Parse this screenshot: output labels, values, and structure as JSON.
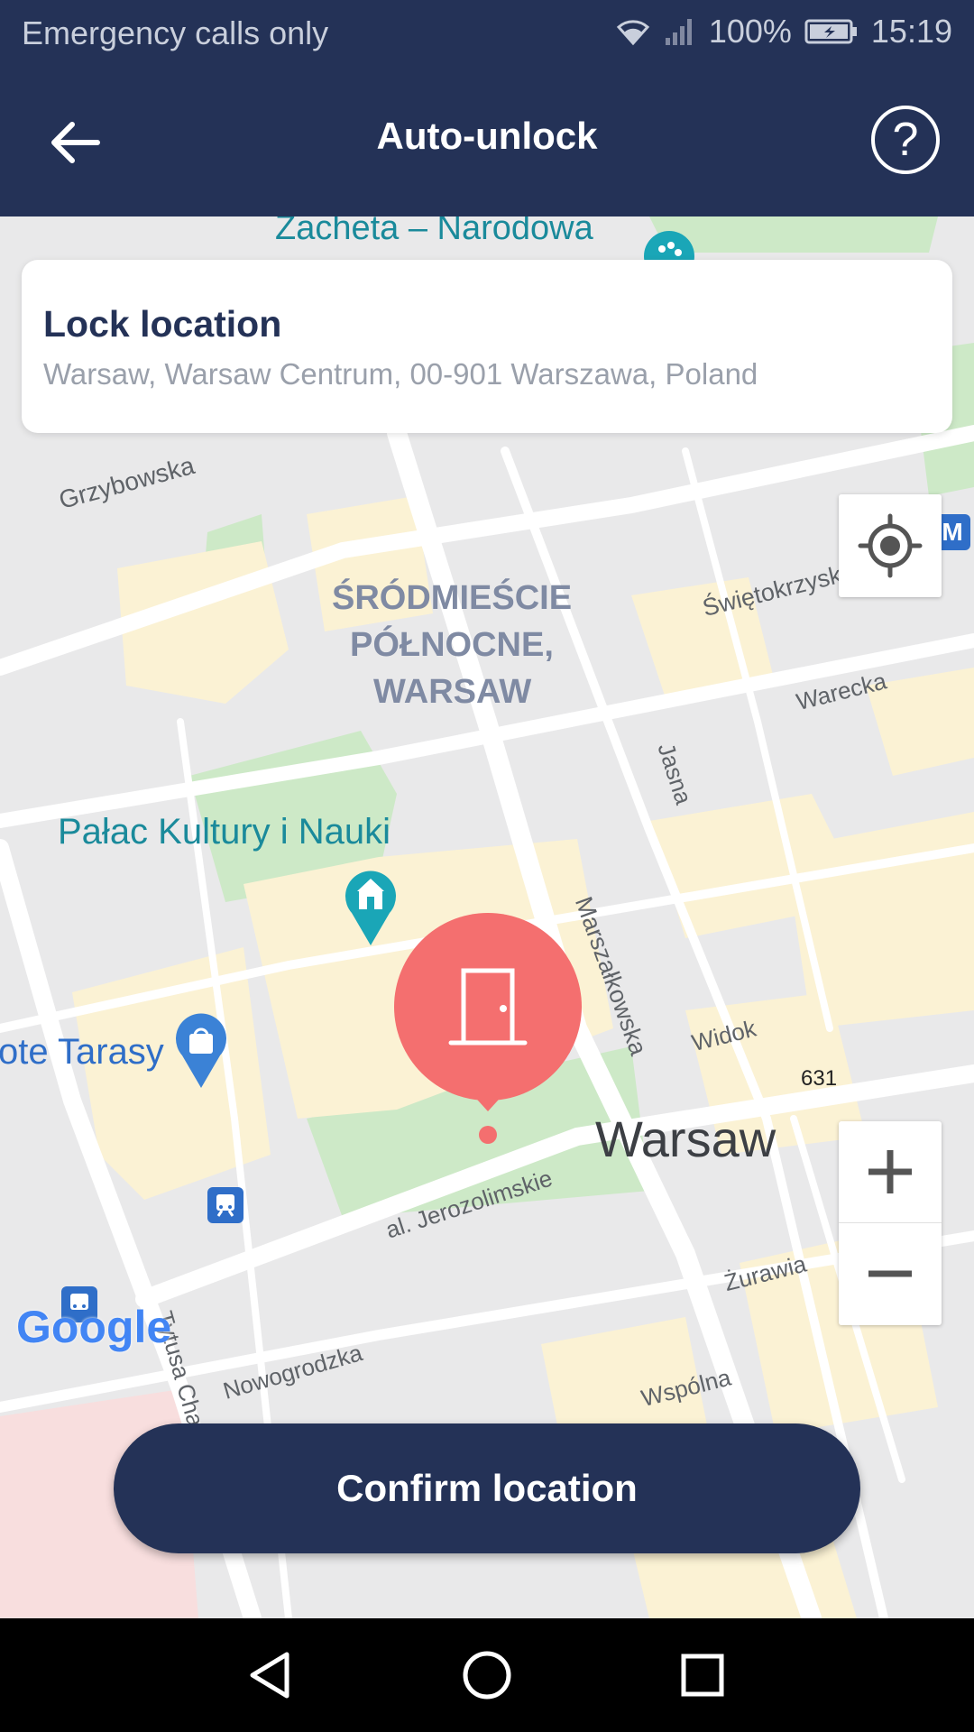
{
  "status_bar": {
    "carrier_text": "Emergency calls only",
    "battery": "100%",
    "time": "15:19",
    "icons": [
      "wifi-icon",
      "signal-icon",
      "battery-icon"
    ]
  },
  "app_bar": {
    "title": "Auto-unlock",
    "back_icon": "arrow-left-icon",
    "help_label": "?"
  },
  "lock_card": {
    "title": "Lock location",
    "address": "Warsaw, Warsaw Centrum, 00-901 Warszawa, Poland"
  },
  "map": {
    "labels": {
      "zacheta": "Zacheta – Narodowa",
      "grzybowska": "Grzybowska",
      "district_line1": "ŚRÓDMIEŚCIE",
      "district_line2": "PÓŁNOCNE,",
      "district_line3": "WARSAW",
      "swietokrzyska": "Świętokrzyska",
      "warecka": "Warecka",
      "jasna": "Jasna",
      "palac": "Pałac Kultury i Nauki",
      "marszalkowska": "Marszałkowska",
      "tarasy": "ote Tarasy",
      "widok": "Widok",
      "route631": "631",
      "warsaw": "Warsaw",
      "jerozolimskie": "al. Jerozolimskie",
      "zurawia": "Żurawia",
      "nowogrodzka": "Nowogrodzka",
      "wspolna": "Wspólna",
      "chalubinskiego": "Tytusa Cha",
      "metro": "M",
      "google": "Google"
    },
    "colors": {
      "background": "#e9e9ea",
      "building": "#fbf2d4",
      "park": "#cde9c7",
      "road": "#ffffff",
      "marker": "#f46f6f",
      "poi_teal": "#1aa6b7",
      "poi_blue": "#3b82d6"
    }
  },
  "controls": {
    "locate_icon": "crosshair-icon",
    "zoom_in_label": "+",
    "zoom_out_label": "−"
  },
  "confirm_button": {
    "label": "Confirm location"
  },
  "nav_bar": {
    "icons": [
      "back-triangle-icon",
      "home-circle-icon",
      "recents-square-icon"
    ]
  }
}
